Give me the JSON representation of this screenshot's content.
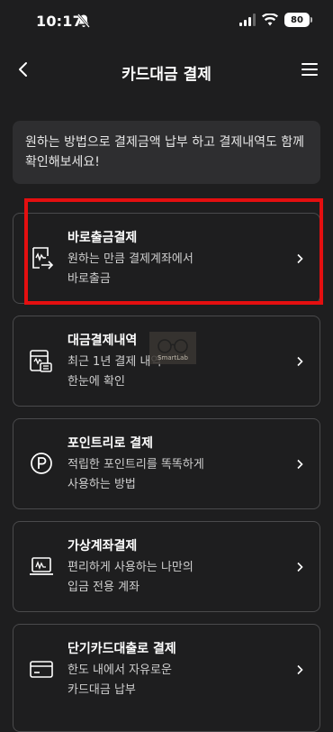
{
  "status_bar": {
    "time": "10:17",
    "battery": "80"
  },
  "header": {
    "title": "카드대금 결제"
  },
  "notice": {
    "text_line1": "원하는 방법으로 결제금액 납부 하고 결제내역도 함께",
    "text_line2": "확인해보세요!"
  },
  "payment_options": [
    {
      "title": "바로출금결제",
      "desc_line1": "원하는 만큼 결제계좌에서",
      "desc_line2": "바로출금",
      "icon": "instant-withdraw-icon"
    },
    {
      "title": "대금결제내역",
      "desc_line1": "최근 1년 결제 내역",
      "desc_line2": "한눈에 확인",
      "icon": "payment-history-icon"
    },
    {
      "title": "포인트리로 결제",
      "desc_line1": "적립한 포인트리를 똑똑하게",
      "desc_line2": "사용하는 방법",
      "icon": "point-icon"
    },
    {
      "title": "가상계좌결제",
      "desc_line1": "편리하게 사용하는 나만의",
      "desc_line2": "입금 전용 계좌",
      "icon": "virtual-account-icon"
    },
    {
      "title": "단기카드대출로 결제",
      "desc_line1": "한도 내에서 자유로운",
      "desc_line2": "카드대금 납부",
      "icon": "card-loan-icon"
    }
  ],
  "watermark": {
    "text": "SmartLab"
  },
  "colors": {
    "background": "#1e1e1f",
    "card_border": "#4a4a4c",
    "notice_bg": "#2e2e30",
    "highlight": "#e40f10"
  }
}
